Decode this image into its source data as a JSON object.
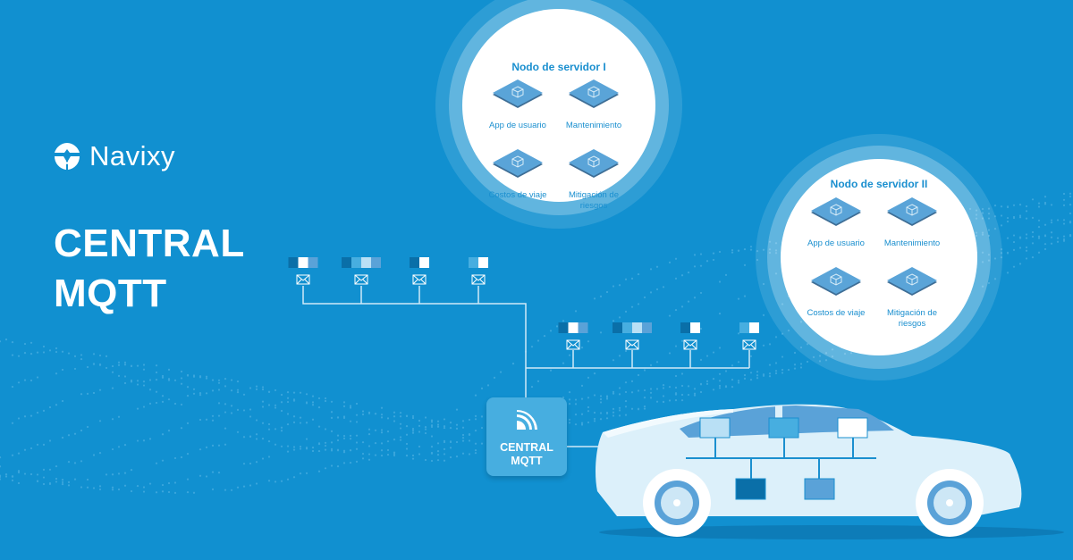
{
  "colors": {
    "background": "#1190d0",
    "node_text": "#1a8fcf",
    "service_tile": "#5aa4d8",
    "hub_box": "#47aee0",
    "car_body": "#dcf0fa",
    "ecu_light": "#b9e0f5",
    "ecu_mid": "#47aee0",
    "ecu_white": "#ffffff",
    "ecu_dark": "#0a6fa8",
    "ecu_medium": "#5aa2d8"
  },
  "brand": {
    "name": "Navixy",
    "logo_icon": "navixy-logo-icon"
  },
  "headline": {
    "line1": "CENTRAL",
    "line2": "MQTT"
  },
  "server_nodes": [
    {
      "title": "Nodo de servidor I",
      "services": [
        {
          "label": "App de usuario",
          "icon": "cube-icon"
        },
        {
          "label": "Mantenimiento",
          "icon": "cube-icon"
        },
        {
          "label": "Costos de viaje",
          "icon": "cube-icon"
        },
        {
          "label": "Mitigación de riesgos",
          "icon": "cube-icon"
        }
      ]
    },
    {
      "title": "Nodo de servidor II",
      "services": [
        {
          "label": "App de usuario",
          "icon": "cube-icon"
        },
        {
          "label": "Mantenimiento",
          "icon": "cube-icon"
        },
        {
          "label": "Costos de viaje",
          "icon": "cube-icon"
        },
        {
          "label": "Mitigación de riesgos",
          "icon": "cube-icon"
        }
      ]
    }
  ],
  "message_rows": [
    {
      "messages": [
        {
          "icon": "envelope-icon",
          "blocks": [
            "#0a6fa8",
            "#ffffff",
            "#5aa2d8"
          ]
        },
        {
          "icon": "envelope-icon",
          "blocks": [
            "#0a6fa8",
            "#47aee0",
            "#b9e0f5",
            "#5aa2d8"
          ]
        },
        {
          "icon": "envelope-icon",
          "blocks": [
            "#0a6fa8",
            "#ffffff"
          ]
        },
        {
          "icon": "envelope-icon",
          "blocks": [
            "#47aee0",
            "#ffffff"
          ]
        }
      ]
    },
    {
      "messages": [
        {
          "icon": "envelope-icon",
          "blocks": [
            "#0a6fa8",
            "#ffffff",
            "#5aa2d8"
          ]
        },
        {
          "icon": "envelope-icon",
          "blocks": [
            "#0a6fa8",
            "#47aee0",
            "#b9e0f5",
            "#5aa2d8"
          ]
        },
        {
          "icon": "envelope-icon",
          "blocks": [
            "#0a6fa8",
            "#ffffff"
          ]
        },
        {
          "icon": "envelope-icon",
          "blocks": [
            "#47aee0",
            "#ffffff"
          ]
        }
      ]
    }
  ],
  "hub": {
    "icon": "wireless-signal-icon",
    "line1": "CENTRAL",
    "line2": "MQTT"
  },
  "vehicle": {
    "icon": "car-icon",
    "ecus_top": [
      "#b9e0f5",
      "#47aee0",
      "#ffffff"
    ],
    "ecus_bottom": [
      "#0a6fa8",
      "#5aa2d8"
    ]
  }
}
